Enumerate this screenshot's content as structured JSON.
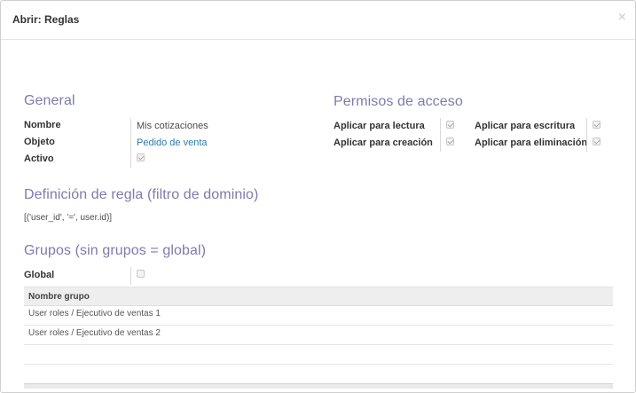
{
  "dialog": {
    "title": "Abrir: Reglas",
    "close_glyph": "×"
  },
  "general": {
    "title": "General",
    "fields": [
      {
        "label": "Nombre",
        "value": "Mis cotizaciones"
      },
      {
        "label": "Objeto",
        "value": "Pedido de venta"
      },
      {
        "label": "Activo",
        "checked": true
      }
    ]
  },
  "access": {
    "title": "Permisos de acceso",
    "perms": [
      {
        "label": "Aplicar para lectura",
        "checked": true
      },
      {
        "label": "Aplicar para escritura",
        "checked": true
      },
      {
        "label": "Aplicar para creación",
        "checked": true
      },
      {
        "label": "Aplicar para eliminación",
        "checked": true
      }
    ]
  },
  "domain": {
    "title": "Definición de regla (filtro de dominio)",
    "value": "[('user_id', '=', user.id)]"
  },
  "groups": {
    "title": "Grupos (sin grupos = global)",
    "global_label": "Global",
    "global_checked": false,
    "column_header": "Nombre grupo",
    "rows": [
      "User roles / Ejecutivo de ventas 1",
      "User roles / Ejecutivo de ventas 2"
    ]
  }
}
